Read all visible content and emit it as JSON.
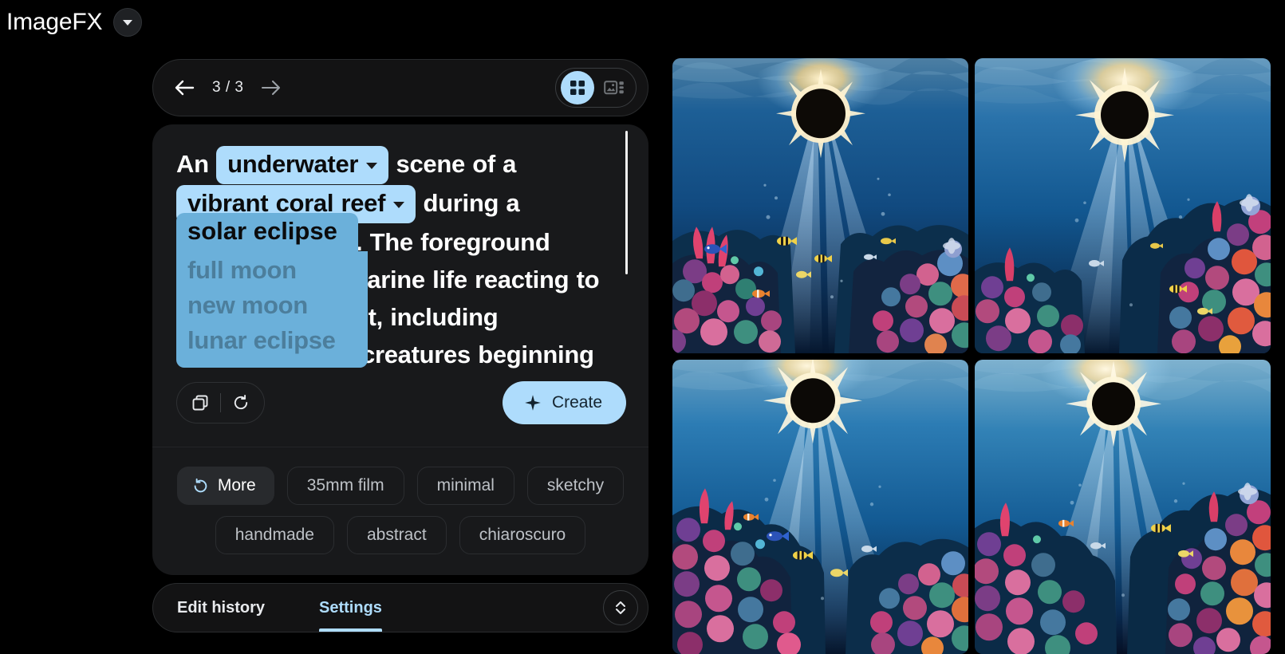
{
  "header": {
    "app_title": "ImageFX",
    "brand_menu_icon": "triangle-down-icon"
  },
  "nav": {
    "back_icon": "arrow-left-icon",
    "forward_icon": "arrow-right-icon",
    "page_counter": "3 / 3",
    "current_page": 3,
    "total_pages": 3,
    "view_toggle": {
      "grid_icon": "grid-view-icon",
      "grid_active": true,
      "detail_icon": "image-detail-view-icon",
      "detail_active": false
    }
  },
  "prompt": {
    "segments": [
      {
        "type": "text",
        "value": "An "
      },
      {
        "type": "chip",
        "value": "underwater",
        "icon": "chevron-down-icon",
        "open": false
      },
      {
        "type": "text",
        "value": " scene of a "
      },
      {
        "type": "chip",
        "value": "vibrant coral reef",
        "icon": "chevron-down-icon",
        "open": false
      },
      {
        "type": "text",
        "value": " during a "
      },
      {
        "type": "chip",
        "value": "solar eclipse",
        "icon": "chevron-up-icon",
        "open": true
      },
      {
        "type": "text",
        "value": ". The foreground features marine life reacting to the shifting light, including creatures beginning"
      }
    ],
    "visible_text_after_chip": ". The foreground features marine life reacting to the shifting light, including creatures beginning",
    "line1_tail": " scene of a",
    "line2_tail": " during a",
    "line3_tail": ". The foreground",
    "line4_tail": "marine life reacting to",
    "line5_tail": "nt, including",
    "line6_tail": "creatures beginning",
    "an_prefix": "An",
    "open_chip": {
      "selected": "solar eclipse",
      "options": [
        "full moon",
        "new moon",
        "lunar eclipse"
      ]
    },
    "scrollbar": "prompt-scrollbar"
  },
  "actions": {
    "copy_icon": "copy-icon",
    "reset_icon": "refresh-reset-icon",
    "create_label": "Create",
    "create_icon": "sparkle-icon"
  },
  "styles": {
    "row1": [
      {
        "label": "More",
        "icon": "refresh-icon",
        "active": true
      },
      {
        "label": "35mm film",
        "active": false
      },
      {
        "label": "minimal",
        "active": false
      },
      {
        "label": "sketchy",
        "active": false
      }
    ],
    "row2": [
      {
        "label": "handmade",
        "active": false
      },
      {
        "label": "abstract",
        "active": false
      },
      {
        "label": "chiaroscuro",
        "active": false
      }
    ]
  },
  "tabs": {
    "items": [
      {
        "label": "Edit history",
        "active": false
      },
      {
        "label": "Settings",
        "active": true
      }
    ],
    "expand_icon": "expand-collapse-chevrons-icon"
  },
  "colors": {
    "background": "#000000",
    "card": "#18191b",
    "accent_blue": "#aedcfc",
    "chip_open_blue": "#6bb0da",
    "dropdown_option_text": "#4c7e9c",
    "text_primary": "#ffffff",
    "text_secondary": "#bdc1c6",
    "border": "#2a2c2e"
  },
  "image_grid": {
    "count": 4,
    "subject": "underwater coral reef scene during a solar eclipse",
    "items": [
      {
        "id": 1,
        "alt": "Underwater coral reef with solar eclipse, light rays, blue water"
      },
      {
        "id": 2,
        "alt": "Underwater coral reef with solar eclipse, dense colorful corals right"
      },
      {
        "id": 3,
        "alt": "Underwater coral reef with solar eclipse, fish and coral foreground"
      },
      {
        "id": 4,
        "alt": "Underwater coral reef with solar eclipse, orange and purple corals"
      }
    ]
  }
}
